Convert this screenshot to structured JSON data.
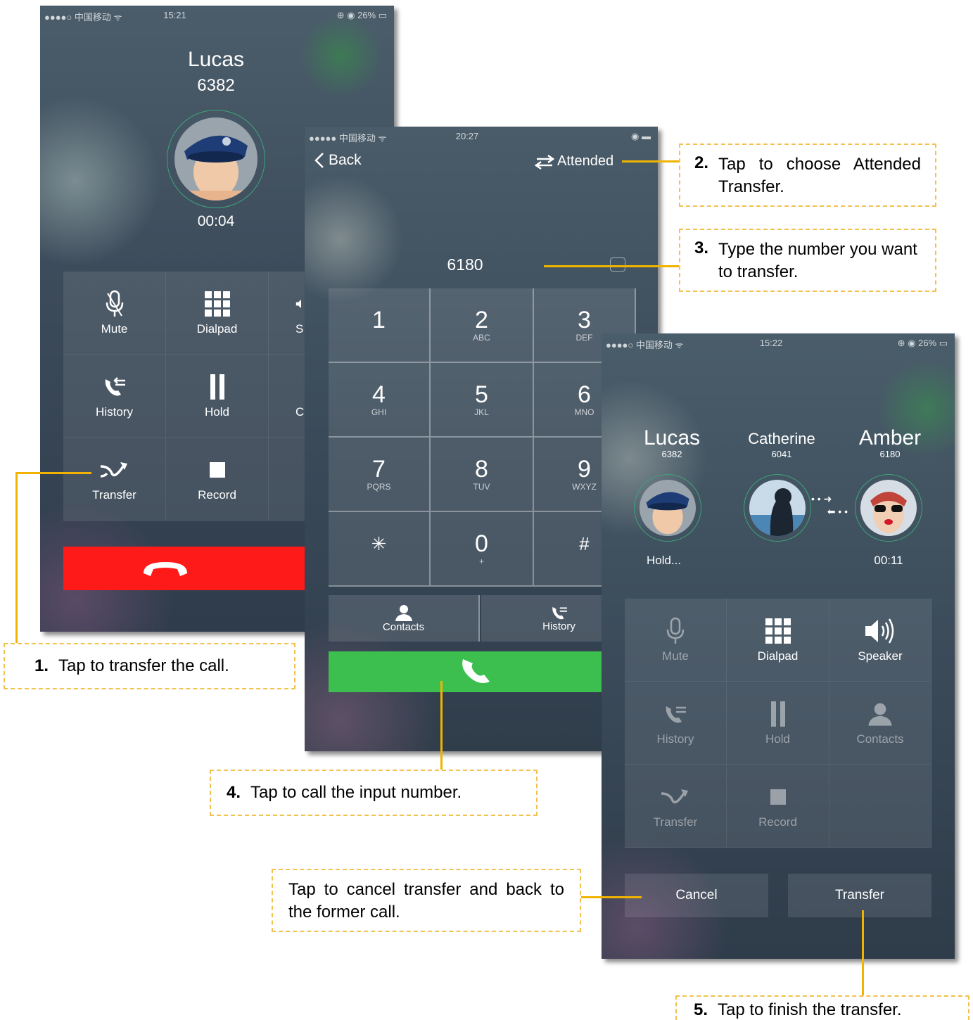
{
  "phone1": {
    "status": {
      "carrier": "●●●●○ 中国移动 ᯤ",
      "time": "15:21",
      "battery": "⊕ ◉ 26% ▭"
    },
    "caller_name": "Lucas",
    "caller_number": "6382",
    "duration": "00:04",
    "controls": [
      {
        "label": "Mute",
        "icon": "mic-icon"
      },
      {
        "label": "Dialpad",
        "icon": "dialpad-icon"
      },
      {
        "label": "S",
        "icon": "speaker-icon"
      },
      {
        "label": "History",
        "icon": "history-icon"
      },
      {
        "label": "Hold",
        "icon": "pause-icon"
      },
      {
        "label": "C",
        "icon": "contacts-icon"
      },
      {
        "label": "Transfer",
        "icon": "transfer-icon"
      },
      {
        "label": "Record",
        "icon": "record-icon"
      }
    ],
    "end_call_color": "#ff1a1a"
  },
  "phone2": {
    "status": {
      "carrier": "●●●●● 中国移动 ᯤ",
      "time": "20:27",
      "battery": "◉ ▬"
    },
    "back_label": "Back",
    "transfer_mode_label": "Attended",
    "input_number": "6180",
    "keys": [
      {
        "digit": "1",
        "letters": ""
      },
      {
        "digit": "2",
        "letters": "ABC"
      },
      {
        "digit": "3",
        "letters": "DEF"
      },
      {
        "digit": "4",
        "letters": "GHI"
      },
      {
        "digit": "5",
        "letters": "JKL"
      },
      {
        "digit": "6",
        "letters": "MNO"
      },
      {
        "digit": "7",
        "letters": "PQRS"
      },
      {
        "digit": "8",
        "letters": "TUV"
      },
      {
        "digit": "9",
        "letters": "WXYZ"
      },
      {
        "digit": "✳",
        "letters": ""
      },
      {
        "digit": "0",
        "letters": "+"
      },
      {
        "digit": "#",
        "letters": ""
      }
    ],
    "contacts_label": "Contacts",
    "history_label": "History",
    "call_color": "#3cbf4e"
  },
  "phone3": {
    "status": {
      "carrier": "●●●●○ 中国移动 ᯤ",
      "time": "15:22",
      "battery": "⊕ ◉ 26% ▭"
    },
    "party1": {
      "name": "Lucas",
      "number": "6382",
      "state": "Hold..."
    },
    "party2": {
      "name": "Catherine",
      "number": "6041"
    },
    "party3": {
      "name": "Amber",
      "number": "6180",
      "duration": "00:11"
    },
    "controls": [
      {
        "label": "Mute",
        "icon": "mic-icon",
        "enabled": false
      },
      {
        "label": "Dialpad",
        "icon": "dialpad-icon",
        "enabled": true
      },
      {
        "label": "Speaker",
        "icon": "speaker-icon",
        "enabled": true
      },
      {
        "label": "History",
        "icon": "history-icon",
        "enabled": false
      },
      {
        "label": "Hold",
        "icon": "pause-icon",
        "enabled": false
      },
      {
        "label": "Contacts",
        "icon": "contacts-icon",
        "enabled": false
      },
      {
        "label": "Transfer",
        "icon": "transfer-icon",
        "enabled": false
      },
      {
        "label": "Record",
        "icon": "record-icon",
        "enabled": false
      }
    ],
    "cancel_label": "Cancel",
    "transfer_label": "Transfer"
  },
  "callouts": {
    "c1": {
      "num": "1.",
      "text": "Tap to transfer the call."
    },
    "c2": {
      "num": "2.",
      "text": "Tap to choose Attended Transfer."
    },
    "c3": {
      "num": "3.",
      "text": "Type the number you want to transfer."
    },
    "c4": {
      "num": "4.",
      "text": "Tap to call the input number."
    },
    "c5": {
      "num": "5.",
      "text": "Tap to finish the transfer."
    },
    "cancel": {
      "text": "Tap to cancel transfer and back to the former call."
    }
  },
  "colors": {
    "callout_border": "#f2c14e",
    "callout_line": "#f0b400"
  }
}
